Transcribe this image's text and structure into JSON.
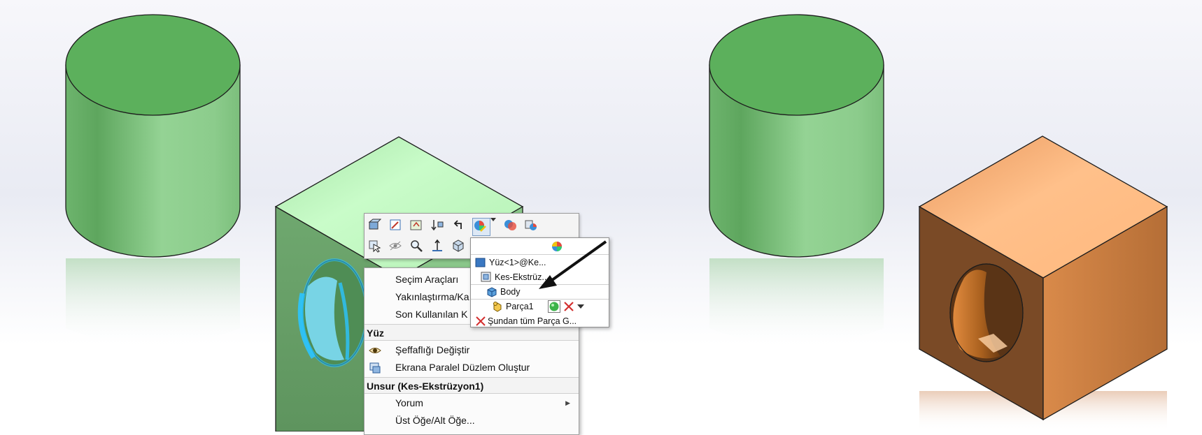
{
  "context_menu": {
    "items": [
      {
        "label": "Seçim Araçları"
      },
      {
        "label": "Yakınlaştırma/Ka"
      },
      {
        "label": "Son Kullanılan K"
      }
    ],
    "section_face": {
      "header": "Yüz",
      "items": [
        {
          "label": "Şeffaflığı Değiştir",
          "icon": "eye-icon"
        },
        {
          "label": "Ekrana Paralel Düzlem Oluştur",
          "icon": "plane-icon"
        }
      ]
    },
    "section_feature": {
      "header": "Unsur (Kes-Ekstrüzyon1)",
      "items": [
        {
          "label": "Yorum",
          "has_submenu": true
        },
        {
          "label": "Üst Öğe/Alt Öğe..."
        }
      ]
    }
  },
  "appearance_dropdown": {
    "items": [
      {
        "label": "Yüz<1>@Ke...",
        "icon": "face-icon"
      },
      {
        "label": "Kes-Ekstrüz...",
        "icon": "feature-icon"
      },
      {
        "label": "Body",
        "icon": "body-icon"
      },
      {
        "label": "Parça1",
        "icon": "part-icon"
      },
      {
        "label": "Şundan tüm Parça G...",
        "icon": "remove-icon"
      }
    ]
  },
  "colors": {
    "green_face": "#8fd08f",
    "orange_face": "#ffb27a",
    "highlight": "#2bc4ff"
  }
}
